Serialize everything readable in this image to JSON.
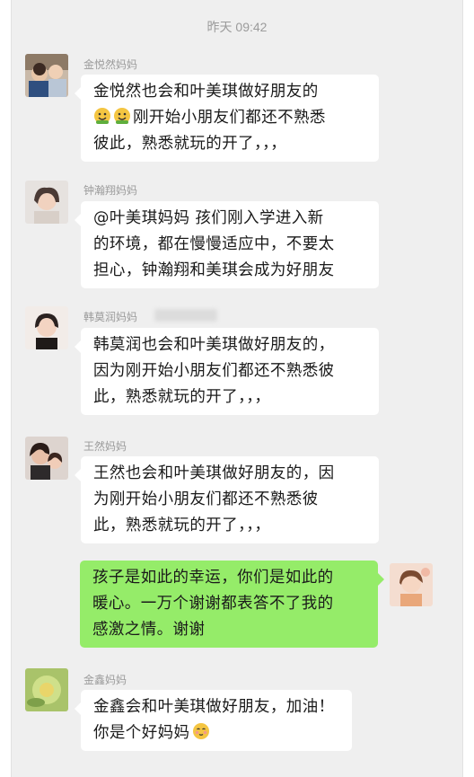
{
  "timestamp": "昨天 09:42",
  "messages": [
    {
      "sender": "金悦然妈妈",
      "lines": [
        "金悦然也会和叶美琪做好朋友的",
        "刚开始小朋友们都还不熟悉",
        "彼此，熟悉就玩的开了，，，"
      ],
      "emoji_line1": [
        "smile-emoji",
        "smile-emoji"
      ]
    },
    {
      "sender": "钟瀚翔妈妈",
      "lines": [
        "@叶美琪妈妈  孩们刚入学进入新",
        "的环境，都在慢慢适应中，不要太",
        "担心，钟瀚翔和美琪会成为好朋友"
      ]
    },
    {
      "sender": "韩莫润妈妈",
      "lines": [
        "韩莫润也会和叶美琪做好朋友的，",
        "因为刚开始小朋友们都还不熟悉彼",
        "此，熟悉就玩的开了，，，"
      ]
    },
    {
      "sender": "王然妈妈",
      "lines": [
        "王然也会和叶美琪做好朋友的，因",
        "为刚开始小朋友们都还不熟悉彼",
        "此，熟悉就玩的开了，，，"
      ]
    },
    {
      "sender": "",
      "lines": [
        "孩子是如此的幸运，你们是如此的",
        "暖心。一万个谢谢都表答不了我的",
        "感激之情。谢谢"
      ]
    },
    {
      "sender": "金鑫妈妈",
      "lines": [
        "金鑫会和叶美琪做好朋友，加油！",
        "你是个好妈妈"
      ],
      "emoji_end": "blush-emoji"
    }
  ],
  "colors": {
    "chat_bg": "#efefef",
    "own_bubble": "#95ec69",
    "other_bubble": "#ffffff"
  }
}
